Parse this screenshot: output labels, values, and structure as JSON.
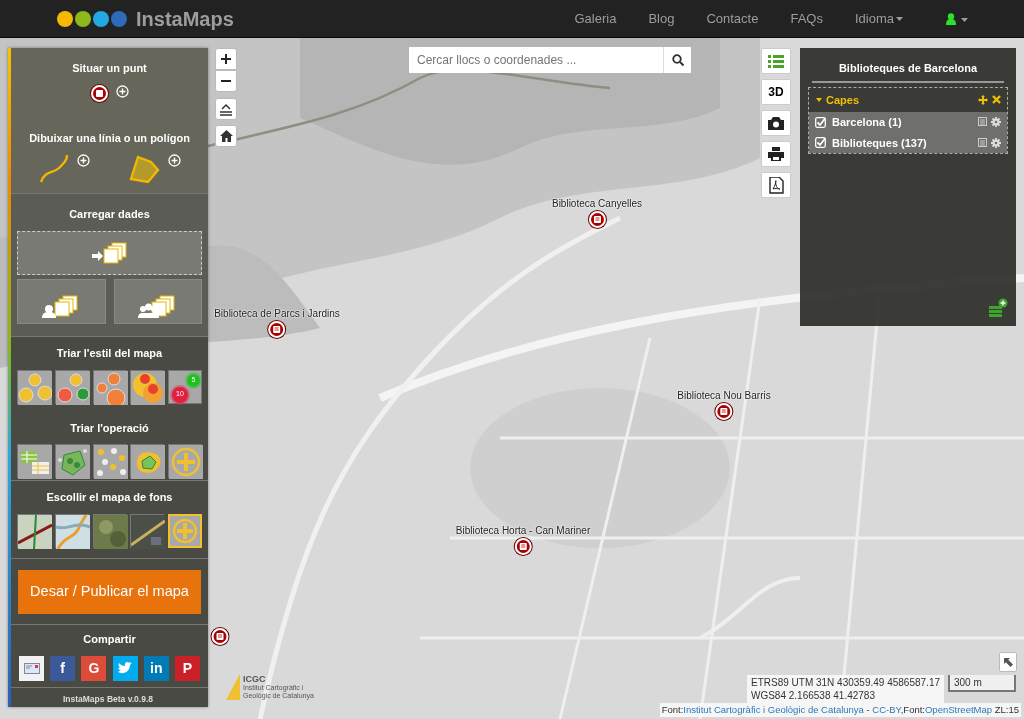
{
  "navbar": {
    "brand": "InstaMaps",
    "links": [
      {
        "label": "Galeria",
        "dropdown": false
      },
      {
        "label": "Blog",
        "dropdown": false
      },
      {
        "label": "Contacte",
        "dropdown": false
      },
      {
        "label": "FAQs",
        "dropdown": false
      },
      {
        "label": "Idioma",
        "dropdown": true
      }
    ]
  },
  "search": {
    "placeholder": "Cercar llocs o coordenades ..."
  },
  "tools": {
    "point_title": "Situar un punt",
    "draw_title": "Dibuixar una línia o un polígon",
    "load_title": "Carregar dades",
    "style_title": "Triar l'estil del mapa",
    "cluster_counts": [
      "10",
      "5"
    ],
    "operation_title": "Triar l'operació",
    "basemap_title": "Escollir el mapa de fons",
    "save_button": "Desar / Publicar el mapa",
    "share_title": "Compartir",
    "share": [
      {
        "kind": "email"
      },
      {
        "kind": "facebook",
        "glyph": "f"
      },
      {
        "kind": "google",
        "glyph": "G"
      },
      {
        "kind": "twitter"
      },
      {
        "kind": "linkedin",
        "glyph": "in"
      },
      {
        "kind": "pinterest",
        "glyph": "P"
      }
    ],
    "version": "InstaMaps Beta v.0.9.8"
  },
  "map_buttons": {
    "three_d": "3D"
  },
  "markers": [
    {
      "kind": "library",
      "label": "Biblioteca Canyelles"
    },
    {
      "kind": "library",
      "label": "Biblioteca de Parcs i Jardins"
    },
    {
      "kind": "library",
      "label": "Biblioteca Nou Barris"
    },
    {
      "kind": "library",
      "label": "Biblioteca Horta - Can Mariner"
    },
    {
      "kind": "library"
    }
  ],
  "layers_panel": {
    "title": "Biblioteques de Barcelona",
    "group": "Capes",
    "expanded": true,
    "layers": [
      {
        "name": "Barcelona (1)",
        "checked": true
      },
      {
        "name": "Biblioteques (137)",
        "checked": true
      }
    ]
  },
  "footer": {
    "logo": "ICGC",
    "logo_caption": "Institut Cartogràfic i Geològic de Catalunya",
    "utm": "ETRS89 UTM 31N 430359.49 4586587.17",
    "wgs": "WGS84 2.166538 41.42783",
    "scale": "300 m",
    "attribution": [
      {
        "text": "Font:",
        "link": false
      },
      {
        "text": "Institut Cartogràfic i Geològic de Catalunya",
        "link": true
      },
      {
        "text": " - ",
        "link": false
      },
      {
        "text": "CC-BY",
        "link": true
      },
      {
        "text": ",Font:",
        "link": false
      },
      {
        "text": "OpenStreetMap",
        "link": true
      },
      {
        "text": " ZL:15",
        "link": false
      }
    ]
  }
}
